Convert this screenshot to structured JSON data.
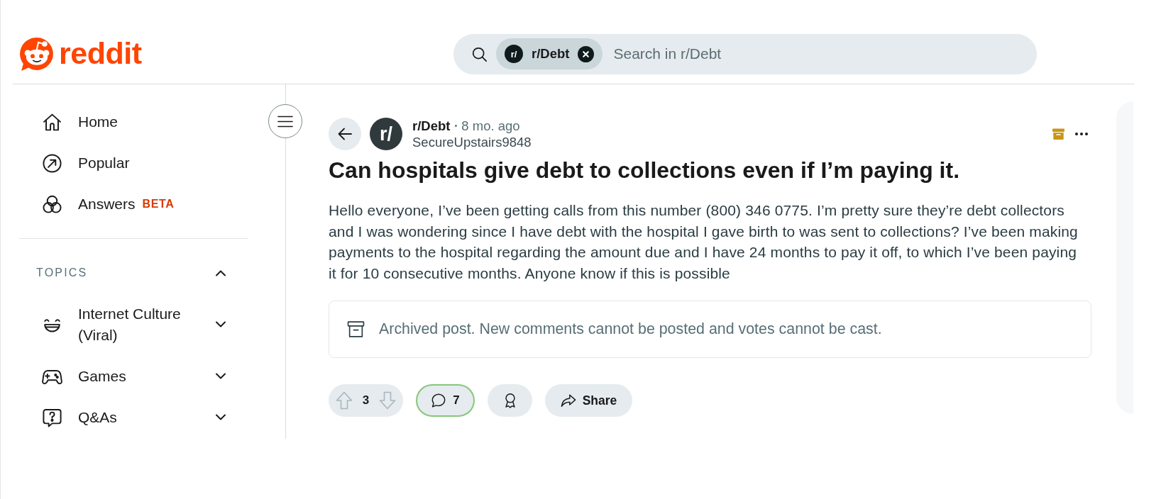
{
  "header": {
    "logo": {
      "wordmark": "reddit"
    },
    "search": {
      "scope_chip": {
        "avatar_text": "r/",
        "label": "r/Debt"
      },
      "placeholder": "Search in r/Debt"
    }
  },
  "sidebar": {
    "nav_items": [
      {
        "label": "Home"
      },
      {
        "label": "Popular"
      },
      {
        "label": "Answers",
        "badge": "BETA"
      }
    ],
    "topics": {
      "heading": "TOPICS",
      "expanded": true,
      "items": [
        {
          "label": "Internet Culture (Viral)",
          "expanded": false
        },
        {
          "label": "Games",
          "expanded": false
        },
        {
          "label": "Q&As",
          "expanded": false
        }
      ]
    }
  },
  "post": {
    "subreddit": "r/Debt",
    "avatar_text": "r/",
    "separator": "•",
    "age": "8 mo. ago",
    "author": "SecureUpstairs9848",
    "archived": true,
    "title": "Can hospitals give debt to collections even if I’m paying it.",
    "body": "Hello everyone, I’ve been getting calls from this number (800) 346 0775. I’m pretty sure they’re debt collectors and I was wondering since I have debt with the hospital I gave birth to was sent to collections? I’ve been making payments to the hospital regarding the amount due and I have 24 months to pay it off, to which I’ve been paying it for 10 consecutive months. Anyone know if this is possible",
    "archived_notice": "Archived post. New comments cannot be posted and votes cannot be cast.",
    "votes": {
      "score": "3",
      "disabled": true
    },
    "comments": {
      "count": "7",
      "highlighted": true
    },
    "share": {
      "label": "Share"
    }
  }
}
